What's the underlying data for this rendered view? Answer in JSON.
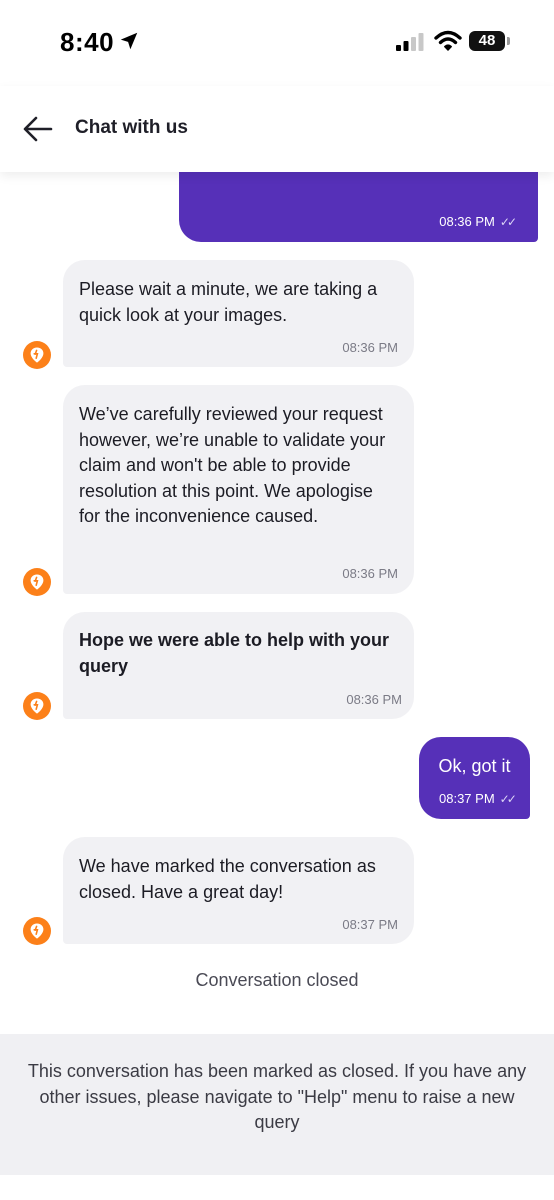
{
  "status_bar": {
    "time": "8:40",
    "battery": "48"
  },
  "header": {
    "title": "Chat with us"
  },
  "messages": [
    {
      "side": "out",
      "type": "images",
      "time": "08:36 PM"
    },
    {
      "side": "in",
      "text": "Please wait a minute, we are taking a quick look at your images.",
      "time": "08:36 PM"
    },
    {
      "side": "in",
      "text": "We’ve carefully reviewed your request however, we’re unable to validate your claim and won't be able to provide resolution at this point. We apologise for the inconvenience caused.",
      "time": "08:36 PM"
    },
    {
      "side": "in",
      "text": "Hope we were able to help with your query",
      "time": "08:36 PM"
    },
    {
      "side": "out",
      "text": "Ok, got it",
      "time": "08:37 PM"
    },
    {
      "side": "in",
      "text": "We have marked the conversation as closed. Have a great day!",
      "time": "08:37 PM"
    }
  ],
  "closed_label": "Conversation closed",
  "footer_note": "This conversation has been marked as closed. If you have any other issues, please navigate to \"Help\" menu to raise a new query",
  "colors": {
    "outgoing_bubble": "#5630b8",
    "incoming_bubble": "#f1f1f4",
    "avatar": "#fc8019"
  },
  "icons": {
    "back": "arrow-left-icon",
    "location": "location-arrow-icon",
    "signal": "cellular-signal-icon",
    "wifi": "wifi-icon",
    "avatar": "brand-logo-icon",
    "read_receipt": "double-check-icon"
  }
}
